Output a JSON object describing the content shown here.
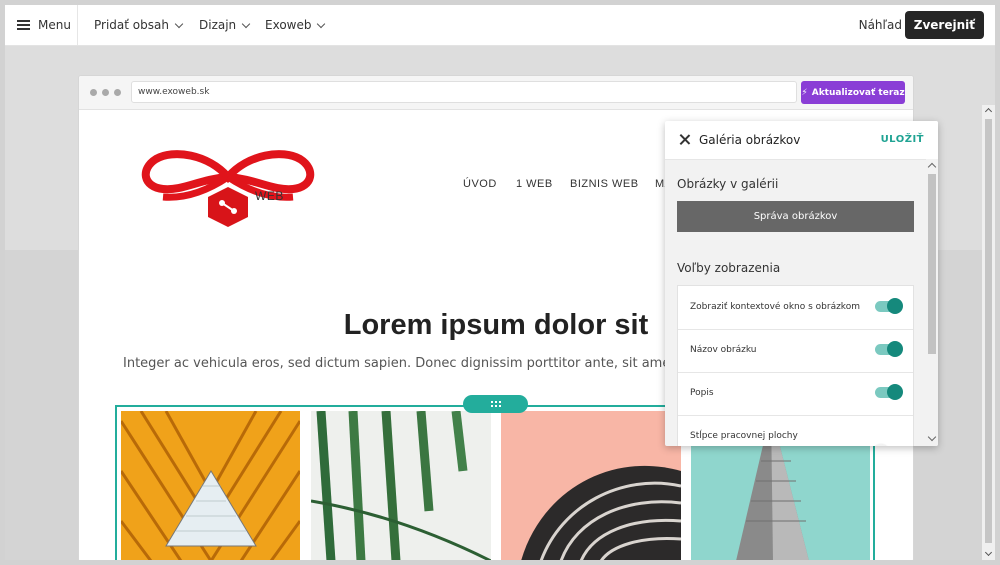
{
  "topbar": {
    "menu_label": "Menu",
    "add_content_label": "Pridať obsah",
    "design_label": "Dizajn",
    "site_label": "Exoweb",
    "preview_label": "Náhľad",
    "publish_label": "Zverejniť"
  },
  "browser": {
    "url": "www.exoweb.sk",
    "update_label": "Aktualizovať teraz"
  },
  "site": {
    "logo_text": "WEB",
    "nav": [
      "ÚVOD",
      "1 WEB",
      "BIZNIS WEB",
      "MA"
    ],
    "hero_title": "Lorem ipsum dolor sit",
    "hero_subtitle": "Integer ac vehicula eros, sed dictum sapien. Donec dignissim porttitor ante, sit amet placerat do"
  },
  "panel": {
    "title": "Galéria obrázkov",
    "save_label": "ULOŽIŤ",
    "images_section": "Obrázky v galérii",
    "manage_label": "Správa obrázkov",
    "display_section": "Voľby zobrazenia",
    "options": [
      {
        "label": "Zobraziť kontextové okno s obrázkom",
        "on": true
      },
      {
        "label": "Názov obrázku",
        "on": true
      },
      {
        "label": "Popis",
        "on": true
      },
      {
        "label": "Stĺpce pracovnej plochy",
        "on": false
      }
    ]
  },
  "colors": {
    "accent": "#23ad9c",
    "update_button": "#8a3ed6",
    "publish_button": "#262626",
    "logo_red": "#e0141b"
  }
}
